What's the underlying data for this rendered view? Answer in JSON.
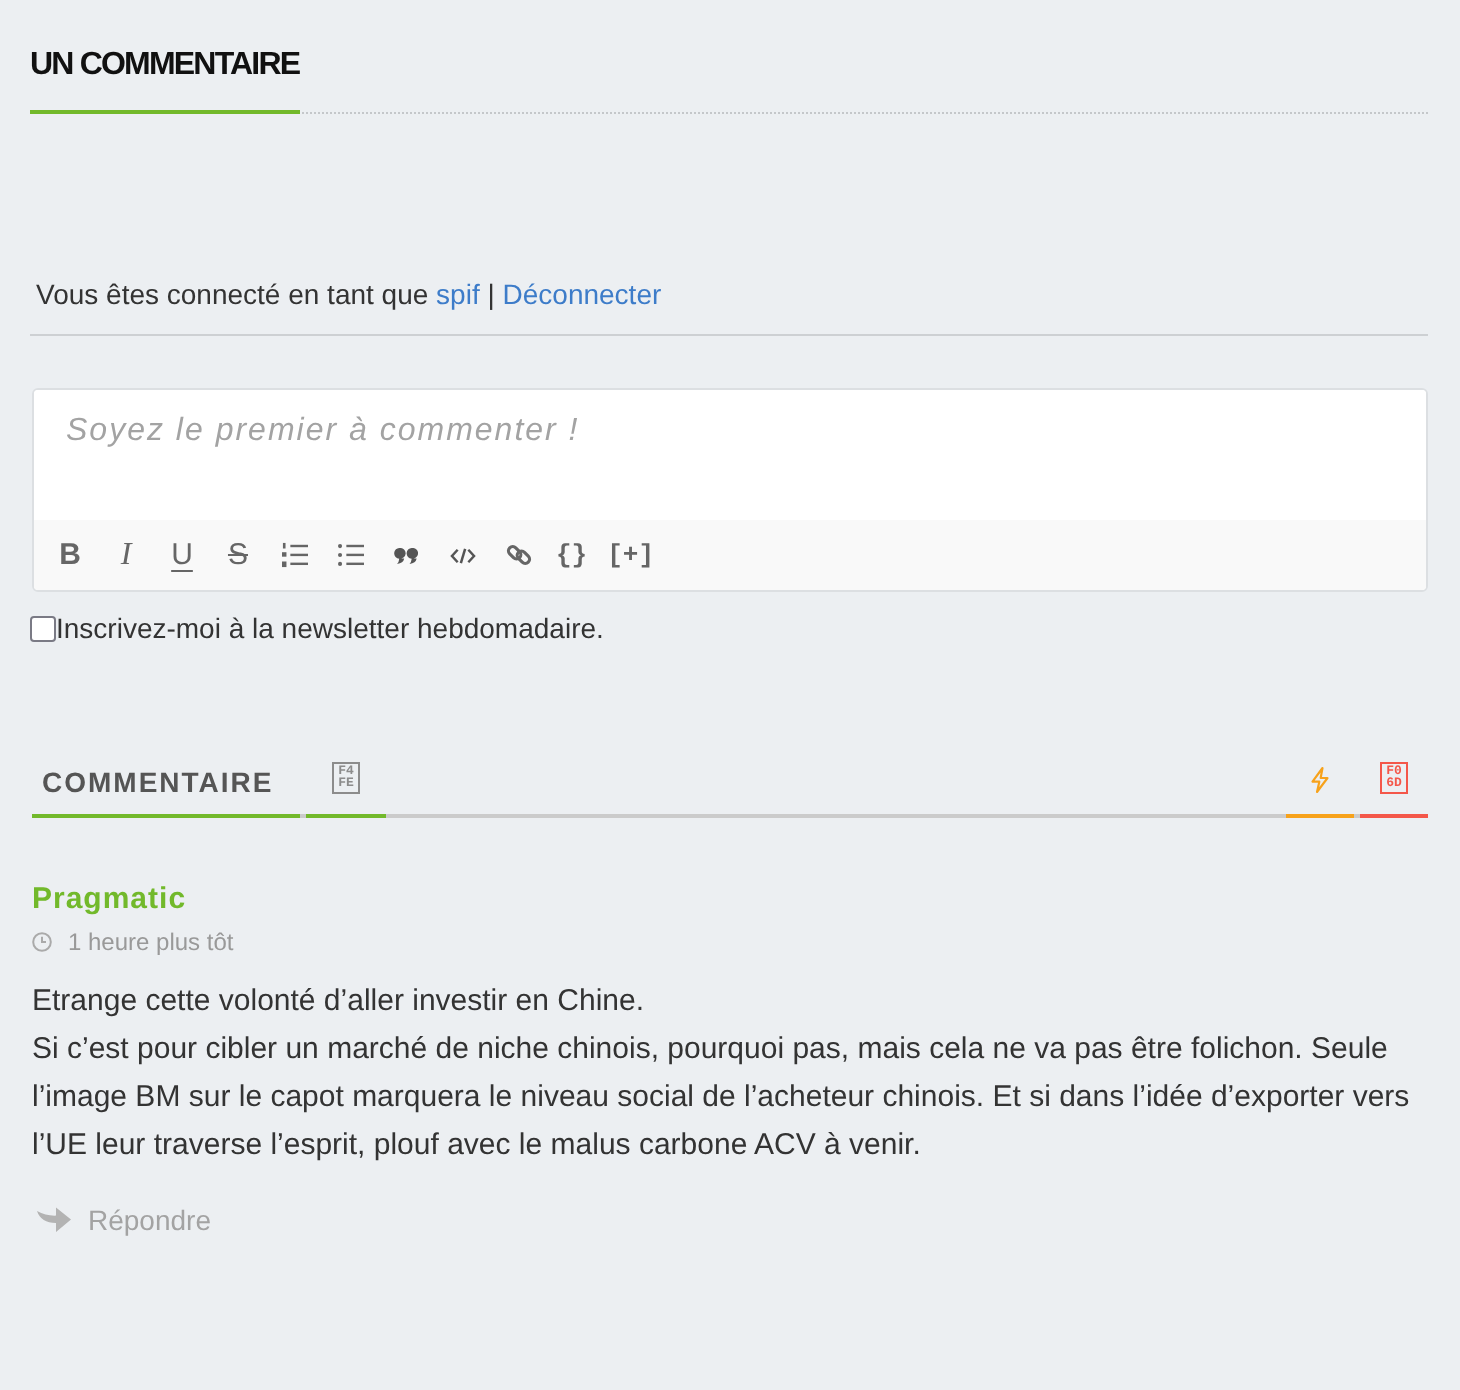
{
  "heading": {
    "title": "UN COMMENTAIRE"
  },
  "login": {
    "prefix": "Vous êtes connecté en tant que",
    "user": "spif",
    "separator": "|",
    "logout": "Déconnecter"
  },
  "editor": {
    "placeholder": "Soyez le premier à commenter !",
    "toolbar": [
      {
        "kind": "bold",
        "label": "B"
      },
      {
        "kind": "italic",
        "label": "I"
      },
      {
        "kind": "underline",
        "label": "U"
      },
      {
        "kind": "strike",
        "label": "S"
      },
      {
        "kind": "ordered-list"
      },
      {
        "kind": "bullet-list"
      },
      {
        "kind": "quote"
      },
      {
        "kind": "code"
      },
      {
        "kind": "link"
      },
      {
        "kind": "text",
        "label": "{}"
      },
      {
        "kind": "text",
        "label": "[+]"
      }
    ]
  },
  "newsletter": {
    "label": "Inscrivez-moi à la newsletter hebdomadaire.",
    "checked": false
  },
  "comment_tabs": {
    "left": [
      {
        "kind": "label",
        "label": "COMMENTAIRE",
        "color": "#72b92b"
      },
      {
        "kind": "glyph",
        "color": "#72b92b",
        "icon": {
          "code": "F4FE",
          "color": "#8c8c8c"
        }
      }
    ],
    "right": [
      {
        "kind": "bolt",
        "color": "#f7a21b",
        "icon": {
          "color": "#f7a21b"
        }
      },
      {
        "kind": "glyph",
        "color": "#f4574a",
        "icon": {
          "code": "F06D",
          "color": "#f4574a"
        }
      }
    ]
  },
  "comments": [
    {
      "author": "Pragmatic",
      "time": "1 heure plus tôt",
      "paragraphs": [
        "Etrange cette volonté d’aller investir en Chine.",
        "Si c’est pour cibler un marché de niche chinois, pourquoi pas, mais cela ne va pas être folichon. Seule l’image BM sur le capot marquera le niveau social de l’acheteur chinois. Et si dans l’idée d’exporter vers l’UE leur traverse l’esprit, plouf avec le malus carbone ACV à venir."
      ],
      "reply": "Répondre"
    }
  ]
}
